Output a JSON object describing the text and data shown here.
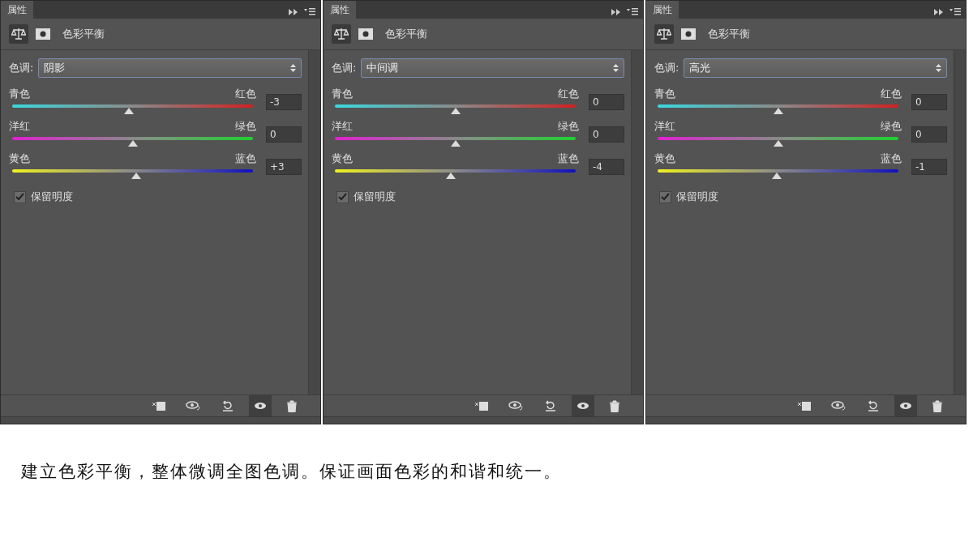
{
  "panels": [
    {
      "tab": "属性",
      "title": "色彩平衡",
      "tone_label": "色调:",
      "tone": "阴影",
      "sliders": [
        {
          "left": "青色",
          "right": "红色",
          "level": 0.485,
          "value": "-3"
        },
        {
          "left": "洋红",
          "right": "绿色",
          "level": 0.5,
          "value": "0"
        },
        {
          "left": "黄色",
          "right": "蓝色",
          "level": 0.515,
          "value": "+3"
        }
      ],
      "preserve": {
        "label": "保留明度",
        "checked": true
      }
    },
    {
      "tab": "属性",
      "title": "色彩平衡",
      "tone_label": "色调:",
      "tone": "中间调",
      "sliders": [
        {
          "left": "青色",
          "right": "红色",
          "level": 0.5,
          "value": "0"
        },
        {
          "left": "洋红",
          "right": "绿色",
          "level": 0.5,
          "value": "0"
        },
        {
          "left": "黄色",
          "right": "蓝色",
          "level": 0.48,
          "value": "-4"
        }
      ],
      "preserve": {
        "label": "保留明度",
        "checked": true
      }
    },
    {
      "tab": "属性",
      "title": "色彩平衡",
      "tone_label": "色调:",
      "tone": "高光",
      "sliders": [
        {
          "left": "青色",
          "right": "红色",
          "level": 0.5,
          "value": "0"
        },
        {
          "left": "洋红",
          "right": "绿色",
          "level": 0.5,
          "value": "0"
        },
        {
          "left": "黄色",
          "right": "蓝色",
          "level": 0.495,
          "value": "-1"
        }
      ],
      "preserve": {
        "label": "保留明度",
        "checked": true
      }
    }
  ],
  "caption": "建立色彩平衡，整体微调全图色调。保证画面色彩的和谐和统一。"
}
